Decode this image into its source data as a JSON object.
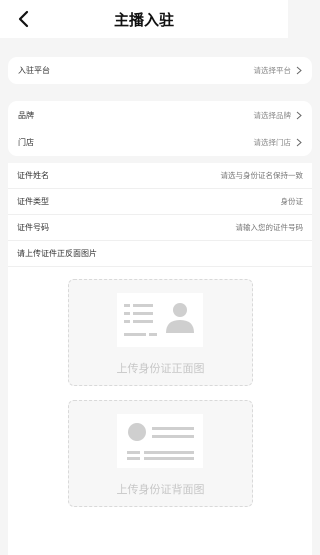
{
  "header": {
    "title": "主播入驻",
    "back_icon": "chevron-left-icon"
  },
  "platform_card": {
    "items": [
      {
        "label": "入驻平台",
        "value": "请选择平台"
      }
    ]
  },
  "brand_card": {
    "items": [
      {
        "label": "品牌",
        "value": "请选择品牌"
      },
      {
        "label": "门店",
        "value": "请选择门店"
      }
    ]
  },
  "form": {
    "name_label": "证件姓名",
    "name_placeholder": "请选与身份证名保持一致",
    "type_label": "证件类型",
    "type_value": "身份证",
    "number_label": "证件号码",
    "number_placeholder": "请输入您的证件号码",
    "upload_title": "请上传证件正反面图片"
  },
  "uploads": {
    "front_caption": "上传身份证正面图",
    "back_caption": "上传身份证背面图"
  },
  "colors": {
    "background": "#f5f5f5",
    "card": "#ffffff",
    "placeholder": "#b3b3b3",
    "illustration": "#cfcfcf"
  }
}
